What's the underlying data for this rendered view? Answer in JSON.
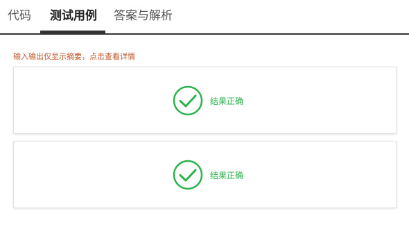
{
  "tabs": [
    {
      "label": "代码",
      "active": false
    },
    {
      "label": "测试用例",
      "active": true
    },
    {
      "label": "答案与解析",
      "active": false
    }
  ],
  "hint": "输入输出仅显示摘要，点击查看详情",
  "cases": [
    {
      "status": "pass",
      "result_label": "结果正确"
    },
    {
      "status": "pass",
      "result_label": "结果正确"
    }
  ],
  "colors": {
    "success": "#2bb24c",
    "hint": "#c1582b",
    "active_tab": "#222222"
  },
  "icons": {
    "result": "check-circle-icon"
  }
}
